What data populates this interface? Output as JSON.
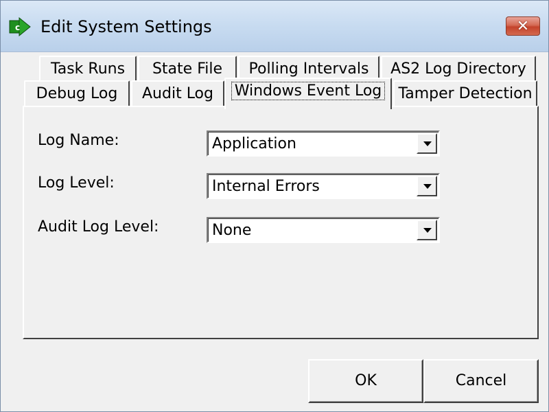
{
  "window": {
    "title": "Edit System Settings",
    "close_label": "✕"
  },
  "tabs": {
    "row1": [
      {
        "label": "Task Runs"
      },
      {
        "label": "State File"
      },
      {
        "label": "Polling Intervals"
      },
      {
        "label": "AS2 Log Directory"
      }
    ],
    "row2": [
      {
        "label": "Debug Log"
      },
      {
        "label": "Audit Log"
      },
      {
        "label": "Windows Event Log",
        "selected": true
      },
      {
        "label": "Tamper Detection"
      }
    ]
  },
  "form": {
    "log_name": {
      "label": "Log Name:",
      "value": "Application"
    },
    "log_level": {
      "label": "Log Level:",
      "value": "Internal Errors"
    },
    "audit_log_level": {
      "label": "Audit Log Level:",
      "value": "None"
    }
  },
  "buttons": {
    "ok": "OK",
    "cancel": "Cancel"
  },
  "colors": {
    "titlebar": "#c9dcf1",
    "close_button": "#c4432b",
    "app_icon": "#1a8a1a",
    "face": "#f0f0f0"
  },
  "icons": {
    "app": "green-arrow-icon",
    "close": "close-icon",
    "dropdown": "chevron-down-icon"
  }
}
